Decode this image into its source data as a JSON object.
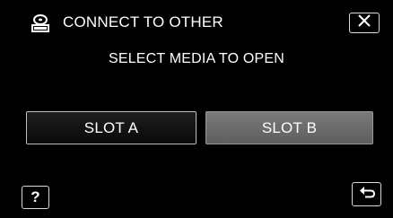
{
  "header": {
    "title": "CONNECT TO OTHER",
    "icon": "disc-drive-icon"
  },
  "prompt": "SELECT MEDIA TO OPEN",
  "slots": [
    {
      "label": "SLOT A",
      "state": "normal"
    },
    {
      "label": "SLOT B",
      "state": "highlighted"
    }
  ],
  "help_button": {
    "label": "?"
  },
  "close_button": {
    "icon": "close-icon"
  },
  "back_button": {
    "icon": "return-arrow-icon"
  },
  "colors": {
    "background": "#000000",
    "text": "#ffffff",
    "slot_b_fill": "#6c6c6c"
  }
}
